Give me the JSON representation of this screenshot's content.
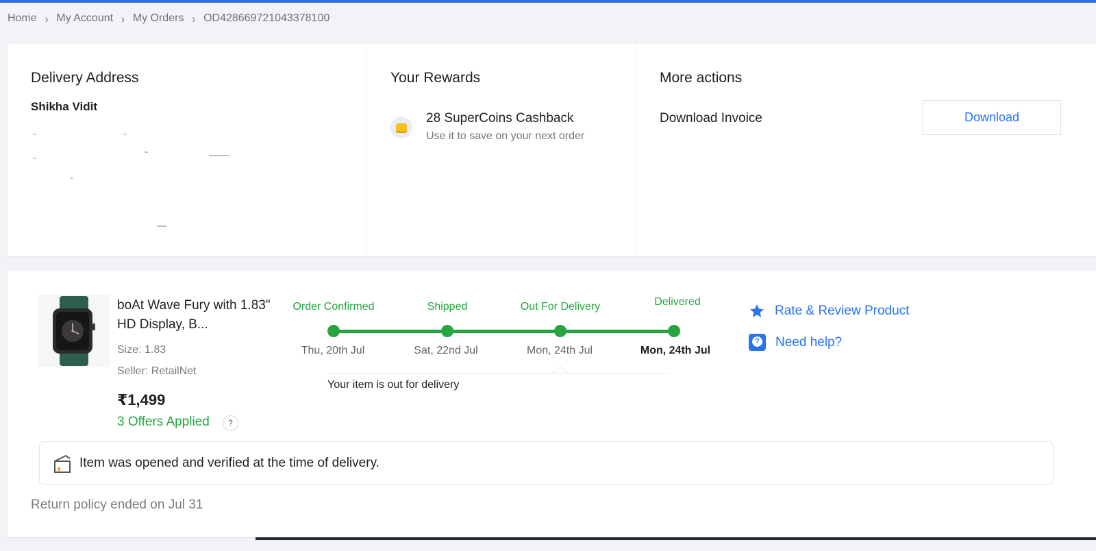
{
  "breadcrumb": {
    "items": [
      "Home",
      "My Account",
      "My Orders",
      "OD428669721043378100"
    ],
    "separator": "›"
  },
  "delivery": {
    "heading": "Delivery Address",
    "name": "Shikha Vidit"
  },
  "rewards": {
    "heading": "Your Rewards",
    "title": "28 SuperCoins Cashback",
    "subtitle": "Use it to save on your next order"
  },
  "actions": {
    "heading": "More actions",
    "invoice_label": "Download Invoice",
    "download_button": "Download"
  },
  "product": {
    "title": "boAt Wave Fury with 1.83\" HD Display, B...",
    "size": "Size: 1.83",
    "seller": "Seller: RetailNet",
    "price": "₹1,499",
    "offers": "3 Offers Applied",
    "offers_help": "?"
  },
  "tracking": {
    "steps": [
      {
        "label": "Order Confirmed",
        "date": "Thu, 20th Jul"
      },
      {
        "label": "Shipped",
        "date": "Sat, 22nd Jul"
      },
      {
        "label": "Out For Delivery",
        "date": "Mon, 24th Jul"
      },
      {
        "label": "Delivered",
        "date": "Mon, 24th Jul"
      }
    ],
    "message": "Your item is out for delivery",
    "color": "#26a541"
  },
  "side_actions": {
    "rate": "Rate & Review Product",
    "help": "Need help?",
    "help_glyph": "?"
  },
  "verification": {
    "text": "Item was opened and verified at the time of delivery."
  },
  "return_policy": "Return policy ended on Jul 31",
  "colors": {
    "accent": "#2874f0",
    "success": "#26a541",
    "top_bar": "#2f6fe0"
  }
}
